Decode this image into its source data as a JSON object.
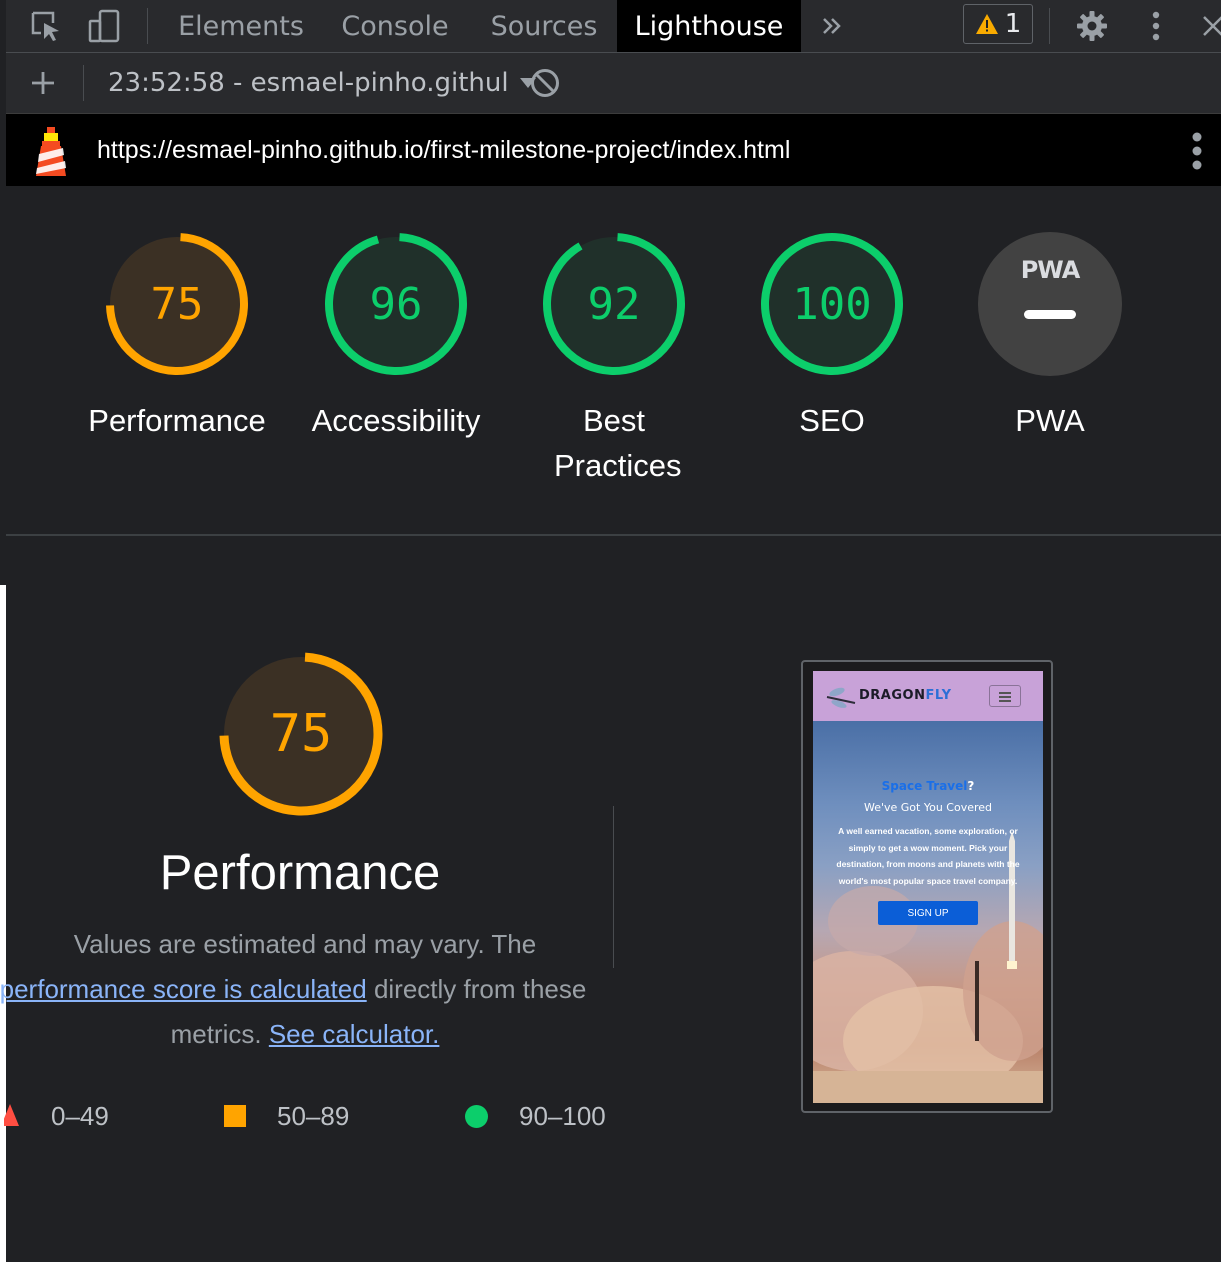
{
  "devtools": {
    "tabs": [
      {
        "label": "Elements"
      },
      {
        "label": "Console"
      },
      {
        "label": "Sources"
      },
      {
        "label": "Lighthouse"
      }
    ],
    "warning_count": "1"
  },
  "toolbar": {
    "report_label": "23:52:58 - esmael-pinho.githul"
  },
  "report": {
    "url": "https://esmael-pinho.github.io/first-milestone-project/index.html"
  },
  "scores": [
    {
      "label": "Performance",
      "value": "75",
      "score": 75,
      "color": "#ffa400"
    },
    {
      "label": "Accessibility",
      "value": "96",
      "score": 96,
      "color": "#0cce6b"
    },
    {
      "label": "Best Practices",
      "value": "92",
      "score": 92,
      "color": "#0cce6b"
    },
    {
      "label": "SEO",
      "value": "100",
      "score": 100,
      "color": "#0cce6b"
    },
    {
      "label": "PWA",
      "value": "",
      "score": null,
      "color": "#9aa0a6"
    }
  ],
  "pwa_badge": "PWA",
  "performance": {
    "score": "75",
    "score_value": 75,
    "title": "Performance",
    "desc_start": "Values are estimated and may vary. The",
    "desc_link": "performance score is calculated",
    "desc_mid": "directly from these metrics.",
    "desc_link2": "See calculator."
  },
  "legend": [
    {
      "range": "0–49",
      "shape": "triangle",
      "color": "#ff4e42"
    },
    {
      "range": "50–89",
      "shape": "square",
      "color": "#ffa400"
    },
    {
      "range": "90–100",
      "shape": "circle",
      "color": "#0cce6b"
    }
  ],
  "screenshot": {
    "brand_a": "DRAGON",
    "brand_b": "FLY",
    "hero_title": "Space Travel",
    "hero_q": "?",
    "hero_subtitle": "We've Got You Covered",
    "hero_text": "A well earned vacation, some exploration, or simply to get a wow moment. Pick your destination, from moons and planets with the world's most popular space travel company.",
    "signup": "SIGN UP"
  },
  "colors": {
    "pass": "#0cce6b",
    "average": "#ffa400",
    "fail": "#ff4e42",
    "link": "#8ab4f8"
  }
}
